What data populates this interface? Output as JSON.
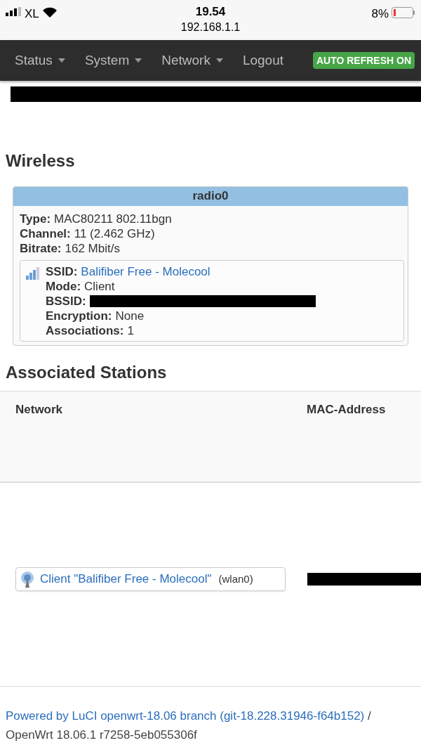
{
  "status_bar": {
    "carrier": "XL",
    "time": "19.54",
    "url": "192.168.1.1",
    "battery": "8%"
  },
  "nav": {
    "menus": [
      {
        "label": "Status",
        "dropdown": true
      },
      {
        "label": "System",
        "dropdown": true
      },
      {
        "label": "Network",
        "dropdown": true
      },
      {
        "label": "Logout",
        "dropdown": false
      }
    ],
    "badge": "AUTO REFRESH ON"
  },
  "wireless": {
    "title": "Wireless",
    "device": {
      "name": "radio0",
      "fields": [
        {
          "label": "Type:",
          "value": "MAC80211 802.11bgn"
        },
        {
          "label": "Channel:",
          "value": "11 (2.462 GHz)"
        },
        {
          "label": "Bitrate:",
          "value": "162 Mbit/s"
        }
      ],
      "network": {
        "fields": [
          {
            "kind": "link",
            "label": "SSID:",
            "value": "Balifiber Free - Molecool"
          },
          {
            "kind": "text",
            "label": "Mode:",
            "value": "Client"
          },
          {
            "kind": "redacted",
            "label": "BSSID:"
          },
          {
            "kind": "text",
            "label": "Encryption:",
            "value": "None"
          },
          {
            "kind": "text",
            "label": "Associations:",
            "value": "1"
          }
        ]
      }
    }
  },
  "stations": {
    "title": "Associated Stations",
    "columns": [
      "Network",
      "MAC-Address"
    ],
    "rows": [
      {
        "network": "Client \"Balifiber Free - Molecool\"",
        "iface": "(wlan0)"
      }
    ]
  },
  "footer": {
    "link": "Powered by LuCI openwrt-18.06 branch (git-18.228.31946-f64b152)",
    "separator": "/",
    "version": "OpenWrt 18.06.1 r7258-5eb055306f"
  }
}
